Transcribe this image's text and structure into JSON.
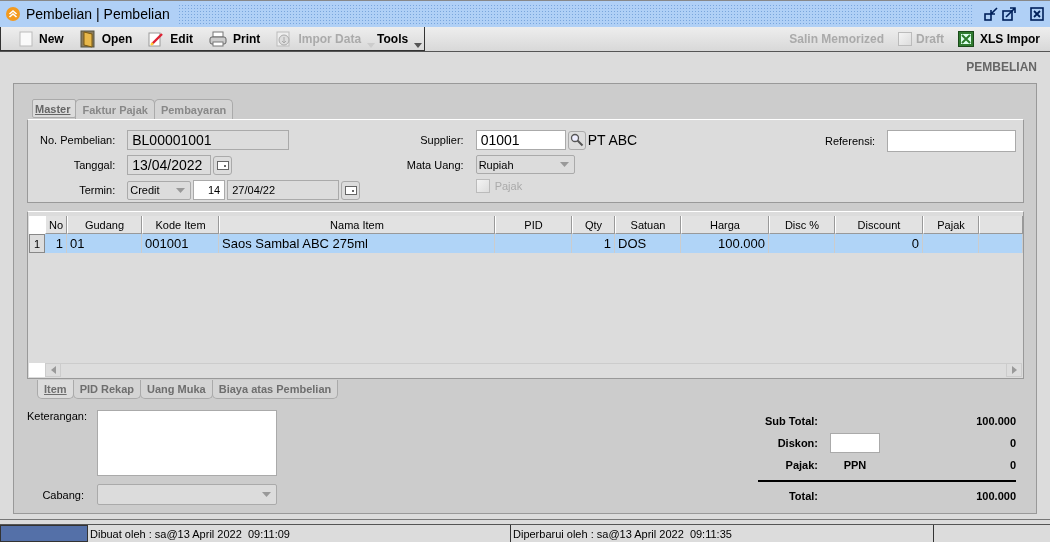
{
  "window": {
    "title": "Pembelian | Pembelian"
  },
  "toolbar": {
    "left": [
      {
        "label": "New",
        "kind": "new",
        "disabled": false
      },
      {
        "label": "Open",
        "kind": "open",
        "disabled": false
      },
      {
        "label": "Edit",
        "kind": "edit",
        "disabled": false
      },
      {
        "label": "Print",
        "kind": "print",
        "disabled": false
      },
      {
        "label": "Impor Data",
        "kind": "import",
        "disabled": true
      },
      {
        "label": "Tools",
        "kind": "menu",
        "disabled": false
      }
    ],
    "right": [
      {
        "label": "Salin Memorized",
        "kind": "text",
        "disabled": true
      },
      {
        "label": "Draft",
        "kind": "check",
        "disabled": true,
        "checked": false
      },
      {
        "label": "XLS Impor",
        "kind": "xls",
        "disabled": false
      }
    ]
  },
  "page_heading": "PEMBELIAN",
  "tabs": [
    {
      "label": "Master",
      "selected": true
    },
    {
      "label": "Faktur Pajak",
      "selected": false
    },
    {
      "label": "Pembayaran",
      "selected": false
    }
  ],
  "form": {
    "no_pembelian": {
      "label": "No. Pembelian:",
      "value": "BL00001001"
    },
    "tanggal": {
      "label": "Tanggal:",
      "value": "13/04/2022"
    },
    "termin": {
      "label": "Termin:",
      "type": "Credit",
      "days": "14",
      "due": "27/04/22"
    },
    "supplier": {
      "label": "Supplier:",
      "code": "01001",
      "name": "PT ABC"
    },
    "mata_uang": {
      "label": "Mata Uang:",
      "value": "Rupiah"
    },
    "pajak": {
      "label": "Pajak",
      "checked": false,
      "disabled": true
    },
    "referensi": {
      "label": "Referensi:"
    }
  },
  "table": {
    "columns": [
      {
        "label": "No"
      },
      {
        "label": "Gudang"
      },
      {
        "label": "Kode Item"
      },
      {
        "label": "Nama Item"
      },
      {
        "label": "PID"
      },
      {
        "label": "Qty"
      },
      {
        "label": "Satuan"
      },
      {
        "label": "Harga"
      },
      {
        "label": "Disc %"
      },
      {
        "label": "Discount"
      },
      {
        "label": "Pajak"
      }
    ],
    "rows": [
      {
        "row_header": "1",
        "selected": true,
        "cells": [
          "1",
          "01",
          "001001",
          "Saos Sambal ABC 275ml",
          null,
          "1",
          "DOS",
          "100.000",
          null,
          "0",
          null
        ]
      }
    ]
  },
  "bottom_tabs": [
    {
      "label": "Item",
      "selected": true
    },
    {
      "label": "PID Rekap",
      "selected": false
    },
    {
      "label": "Uang Muka",
      "selected": false
    },
    {
      "label": "Biaya atas Pembelian",
      "selected": false
    }
  ],
  "notes": {
    "keterangan_label": "Keterangan:",
    "cabang_label": "Cabang:"
  },
  "totals": {
    "sub_total": {
      "label": "Sub Total:",
      "value": "100.000"
    },
    "diskon": {
      "label": "Diskon:",
      "value": "0"
    },
    "pajak": {
      "label": "Pajak:",
      "tax": "PPN",
      "value": "0"
    },
    "total": {
      "label": "Total:",
      "value": "100.000"
    }
  },
  "status_bar": [
    "Dibuat oleh : sa@13 April 2022  09:11:09",
    "Diperbarui oleh : sa@13 April 2022  09:11:35"
  ]
}
